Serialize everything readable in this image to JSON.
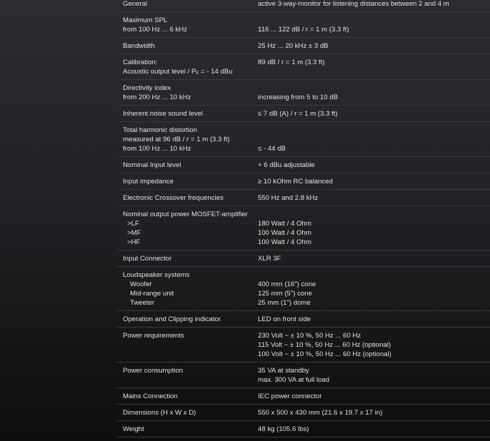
{
  "specs": [
    {
      "label": [
        "General"
      ],
      "value": [
        "active 3-way-monitor for listening distances between 2 and 4 m"
      ]
    },
    {
      "label": [
        "Maximum SPL",
        "from 100 Hz ... 6 kHz"
      ],
      "value": [
        "",
        "116 ... 122 dB / r = 1 m (3.3 ft)"
      ]
    },
    {
      "label": [
        "Bandwidth"
      ],
      "value": [
        "25 Hz ... 20 kHz ± 3 dB"
      ]
    },
    {
      "label": [
        "Calibration:",
        "Acoustic output level / P|E| = - 14 dBu"
      ],
      "value": [
        "89 dB / r = 1 m (3.3 ft)"
      ]
    },
    {
      "label": [
        "Directivity index",
        "from 200 Hz ... 10 kHz"
      ],
      "value": [
        "",
        "increasing from 5 to 10 dB"
      ]
    },
    {
      "label": [
        "Inherent noise sound level"
      ],
      "value": [
        "≤ 7 dB (A) / r = 1 m (3.3 ft)"
      ]
    },
    {
      "label": [
        "Total harmonic distortion",
        "measured at 96 dB / r = 1 m (3.3 ft)",
        "from 100 Hz ... 10 kHz"
      ],
      "value": [
        "",
        "",
        "≤ - 44 dB"
      ]
    },
    {
      "label": [
        "Nominal Input level"
      ],
      "value": [
        "+ 6 dBu adjustable"
      ]
    },
    {
      "label": [
        "Input impedance"
      ],
      "value": [
        "≥ 10 kOhm RC balanced"
      ]
    },
    {
      "label": [
        "Electronic Crossover frequencies"
      ],
      "value": [
        "550 Hz and 2.8 kHz"
      ]
    },
    {
      "label": [
        "Nominal output power MOSFET-amplifier",
        ">LF",
        ">MF",
        ">HF"
      ],
      "value": [
        "",
        "180 Watt / 4 Ohm",
        "100 Watt / 4 Ohm",
        "100 Watt / 4 Ohm"
      ]
    },
    {
      "label": [
        "Input Connector"
      ],
      "value": [
        "XLR 3F"
      ]
    },
    {
      "label": [
        "Loudspeaker systems",
        ">Woofer",
        ">Mid-range unit",
        ">Tweeter"
      ],
      "value": [
        "",
        "400 mm (16\") cone",
        "125 mm (5\") cone",
        "25 mm (1\") dome"
      ]
    },
    {
      "label": [
        "Operation and Clipping indicator"
      ],
      "value": [
        "LED on front side"
      ]
    },
    {
      "label": [
        "Power requirements"
      ],
      "value": [
        "230 Volt ~ ± 10 %, 50 Hz ... 60 Hz",
        "115 Volt ~ ± 10 %, 50 Hz ... 60 Hz (optional)",
        "100 Volt ~ ± 10 %, 50 Hz ... 60 Hz (optional)"
      ]
    },
    {
      "label": [
        "Power consumption"
      ],
      "value": [
        "35 VA at standby",
        "max. 300 VA at full load"
      ]
    },
    {
      "label": [
        "Mains Connection"
      ],
      "value": [
        "IEC power connector"
      ]
    },
    {
      "label": [
        "Dimensions (H x W x D)"
      ],
      "value": [
        "550 x 500 x 430 mm (21.6 x 19.7 x 17 in)"
      ]
    },
    {
      "label": [
        "Weight"
      ],
      "value": [
        "48 kg (105.6 lbs)"
      ]
    }
  ],
  "colors": {
    "text": "#e2e2e2",
    "divider": "#3a3b3f",
    "background_top": "#2b2c30",
    "background_bottom": "#0e0e0f"
  }
}
